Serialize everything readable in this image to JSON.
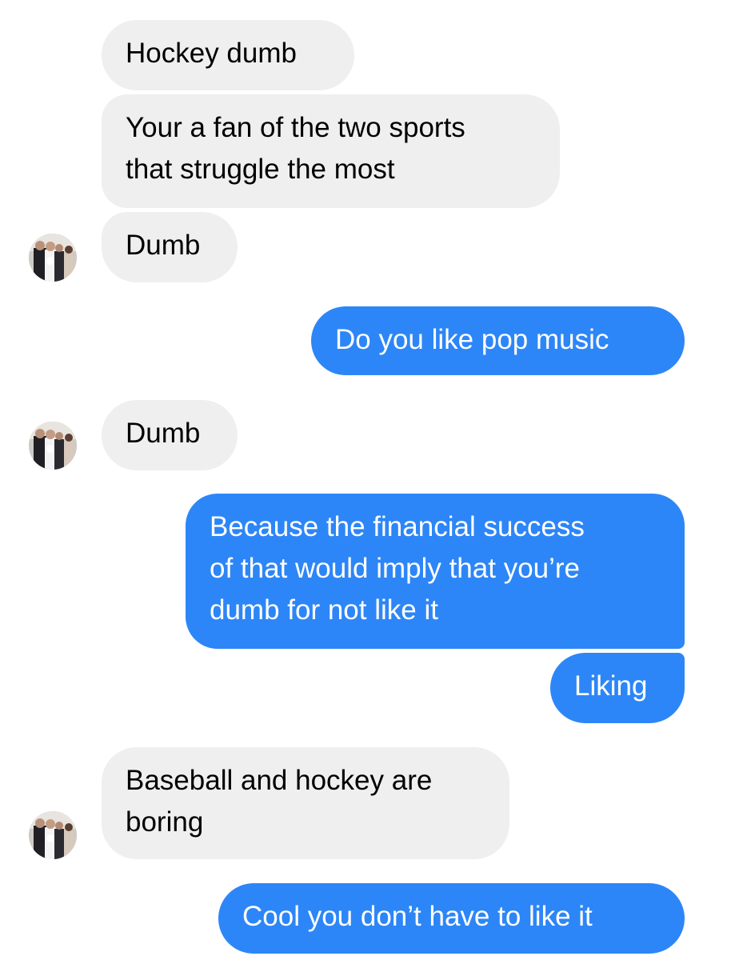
{
  "conversation": {
    "messages": [
      {
        "from": "them",
        "lines": [
          "Hockey dumb"
        ]
      },
      {
        "from": "them",
        "lines": [
          "Your a fan of the two sports",
          "that struggle the most"
        ]
      },
      {
        "from": "them",
        "lines": [
          "Dumb"
        ]
      },
      {
        "from": "me",
        "lines": [
          "Do you like pop music"
        ]
      },
      {
        "from": "them",
        "lines": [
          "Dumb"
        ]
      },
      {
        "from": "me",
        "lines": [
          "Because the financial success",
          "of that would imply that you’re",
          "dumb for not like it"
        ]
      },
      {
        "from": "me",
        "lines": [
          "Liking"
        ]
      },
      {
        "from": "them",
        "lines": [
          "Baseball and hockey are",
          "boring"
        ]
      },
      {
        "from": "me",
        "lines": [
          "Cool you don’t have to like it"
        ]
      }
    ]
  },
  "colors": {
    "incoming_bubble": "#efefef",
    "outgoing_bubble": "#2d86f7",
    "incoming_text": "#000000",
    "outgoing_text": "#ffffff"
  },
  "icons": {
    "contact_avatar": "avatar-photo-icon"
  }
}
